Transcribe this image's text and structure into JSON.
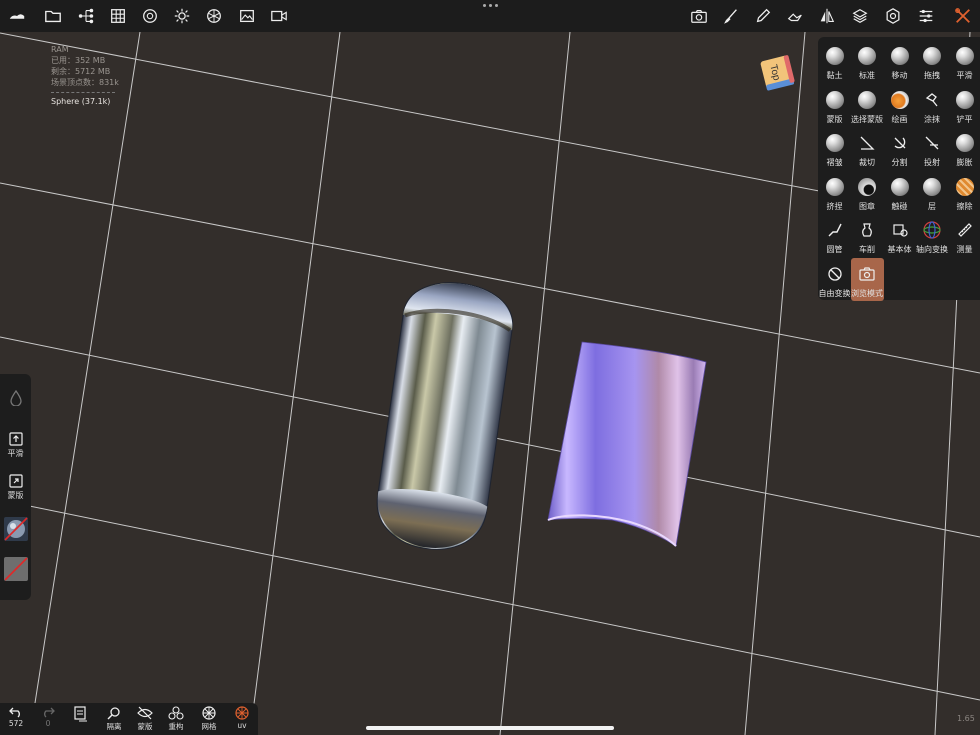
{
  "topbar": {
    "icons": [
      "nomad-logo-icon",
      "folder-icon",
      "scene-tree-icon",
      "grid-menu-icon",
      "material-icon",
      "light-icon",
      "shading-icon",
      "image-icon",
      "video-icon"
    ],
    "right_icons": [
      "camera-icon",
      "brush-icon",
      "eyedropper-icon",
      "hand-icon",
      "symmetry-icon",
      "layers-icon",
      "settings-icon",
      "sliders-icon",
      "tools-icon"
    ]
  },
  "stats": {
    "ram": "RAM",
    "used": "已用：352 MB",
    "free": "剩余：5712 MB",
    "verts": "场景顶点数：831k",
    "object": "Sphere (37.1k)"
  },
  "nav_cube": {
    "label": "Top"
  },
  "tools": [
    {
      "label": "黏土",
      "icon": "clay-icon"
    },
    {
      "label": "标准",
      "icon": "standard-icon"
    },
    {
      "label": "移动",
      "icon": "move-icon"
    },
    {
      "label": "拖拽",
      "icon": "drag-icon"
    },
    {
      "label": "平滑",
      "icon": "smooth-icon"
    },
    {
      "label": "蒙版",
      "icon": "mask-icon"
    },
    {
      "label": "选择蒙版",
      "icon": "select-mask-icon"
    },
    {
      "label": "绘画",
      "icon": "paint-icon"
    },
    {
      "label": "涂抹",
      "icon": "smudge-icon"
    },
    {
      "label": "铲平",
      "icon": "flatten-icon"
    },
    {
      "label": "褶皱",
      "icon": "crease-icon"
    },
    {
      "label": "裁切",
      "icon": "trim-icon"
    },
    {
      "label": "分割",
      "icon": "split-icon"
    },
    {
      "label": "投射",
      "icon": "project-icon"
    },
    {
      "label": "膨胀",
      "icon": "inflate-icon"
    },
    {
      "label": "挤捏",
      "icon": "pinch-icon"
    },
    {
      "label": "图章",
      "icon": "stamp-icon"
    },
    {
      "label": "触碰",
      "icon": "nudge-icon"
    },
    {
      "label": "层",
      "icon": "layer-icon"
    },
    {
      "label": "擦除",
      "icon": "erase-icon"
    },
    {
      "label": "圆管",
      "icon": "tube-icon"
    },
    {
      "label": "车削",
      "icon": "lathe-icon"
    },
    {
      "label": "基本体",
      "icon": "primitive-icon"
    },
    {
      "label": "轴向变换",
      "icon": "gizmo-icon"
    },
    {
      "label": "测量",
      "icon": "ruler-icon"
    },
    {
      "label": "自由变换",
      "icon": "transform-icon"
    },
    {
      "label": "浏览模式",
      "icon": "view-camera-icon"
    }
  ],
  "active_tool": "浏览模式",
  "left_tools": {
    "smooth": "平滑",
    "mask": "蒙版"
  },
  "bottom": {
    "undo_count": "572",
    "redo_count": "0",
    "isolate": "隔离",
    "mask": "蒙版",
    "remesh": "重构",
    "mesh": "网格",
    "uv": "uv"
  },
  "version": "1.65",
  "colors": {
    "accent": "#e0612f",
    "active_tool_bg": "#a8664a",
    "bg": "#332e2b",
    "grid": "#d9d9d9"
  }
}
